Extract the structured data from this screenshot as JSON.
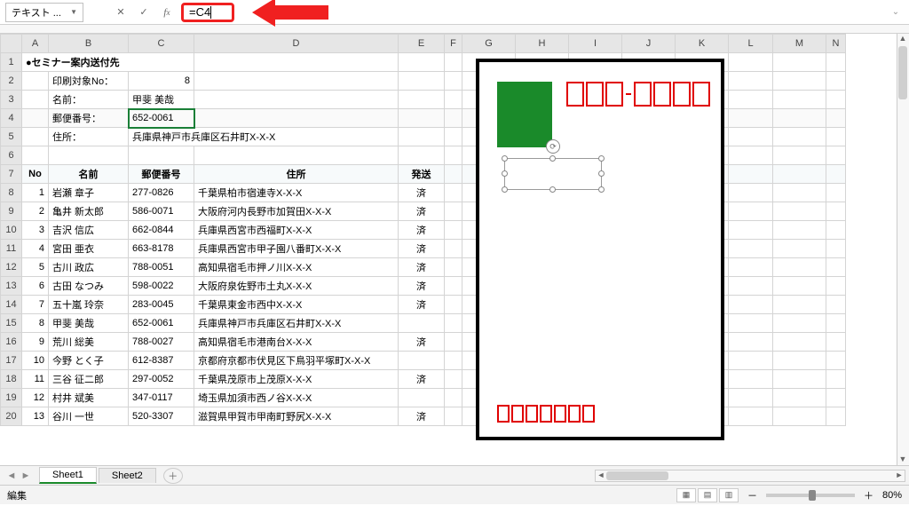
{
  "name_box": "テキスト ...",
  "formula": "=C4",
  "columns": [
    "A",
    "B",
    "C",
    "D",
    "E",
    "F",
    "G",
    "H",
    "I",
    "J",
    "K",
    "L",
    "M",
    "N"
  ],
  "title": "●セミナー案内送付先",
  "summary": {
    "print_target_label": "印刷対象No：",
    "print_target_value": "8",
    "name_label": "名前：",
    "name_value": "甲斐 美哉",
    "postal_label": "郵便番号：",
    "postal_value": "652-0061",
    "address_label": "住所：",
    "address_value": "兵庫県神戸市兵庫区石井町X-X-X"
  },
  "table_headers": {
    "no": "No",
    "name": "名前",
    "postal": "郵便番号",
    "address": "住所",
    "sent": "発送"
  },
  "records": [
    {
      "no": 1,
      "name": "岩瀬 章子",
      "postal": "277-0826",
      "address": "千葉県柏市宿連寺X-X-X",
      "sent": "済"
    },
    {
      "no": 2,
      "name": "亀井 新太郎",
      "postal": "586-0071",
      "address": "大阪府河内長野市加賀田X-X-X",
      "sent": "済"
    },
    {
      "no": 3,
      "name": "吉沢 信広",
      "postal": "662-0844",
      "address": "兵庫県西宮市西福町X-X-X",
      "sent": "済"
    },
    {
      "no": 4,
      "name": "宮田 亜衣",
      "postal": "663-8178",
      "address": "兵庫県西宮市甲子園八番町X-X-X",
      "sent": "済"
    },
    {
      "no": 5,
      "name": "古川 政広",
      "postal": "788-0051",
      "address": "高知県宿毛市押ノ川X-X-X",
      "sent": "済"
    },
    {
      "no": 6,
      "name": "古田 なつみ",
      "postal": "598-0022",
      "address": "大阪府泉佐野市土丸X-X-X",
      "sent": "済"
    },
    {
      "no": 7,
      "name": "五十嵐 玲奈",
      "postal": "283-0045",
      "address": "千葉県東金市西中X-X-X",
      "sent": "済"
    },
    {
      "no": 8,
      "name": "甲斐 美哉",
      "postal": "652-0061",
      "address": "兵庫県神戸市兵庫区石井町X-X-X",
      "sent": ""
    },
    {
      "no": 9,
      "name": "荒川 総美",
      "postal": "788-0027",
      "address": "高知県宿毛市港南台X-X-X",
      "sent": "済"
    },
    {
      "no": 10,
      "name": "今野 とく子",
      "postal": "612-8387",
      "address": "京都府京都市伏見区下鳥羽平塚町X-X-X",
      "sent": ""
    },
    {
      "no": 11,
      "name": "三谷 征二郎",
      "postal": "297-0052",
      "address": "千葉県茂原市上茂原X-X-X",
      "sent": "済"
    },
    {
      "no": 12,
      "name": "村井 斌美",
      "postal": "347-0117",
      "address": "埼玉県加須市西ノ谷X-X-X",
      "sent": ""
    },
    {
      "no": 13,
      "name": "谷川 一世",
      "postal": "520-3307",
      "address": "滋賀県甲賀市甲南町野尻X-X-X",
      "sent": "済"
    }
  ],
  "row_numbers": [
    1,
    2,
    3,
    4,
    5,
    6,
    7,
    8,
    9,
    10,
    11,
    12,
    13,
    14,
    15,
    16,
    17,
    18,
    19,
    20
  ],
  "sheets": {
    "active": "Sheet1",
    "other": "Sheet2"
  },
  "status": {
    "mode": "編集",
    "zoom": "80%",
    "minus": "－",
    "plus": "＋"
  }
}
